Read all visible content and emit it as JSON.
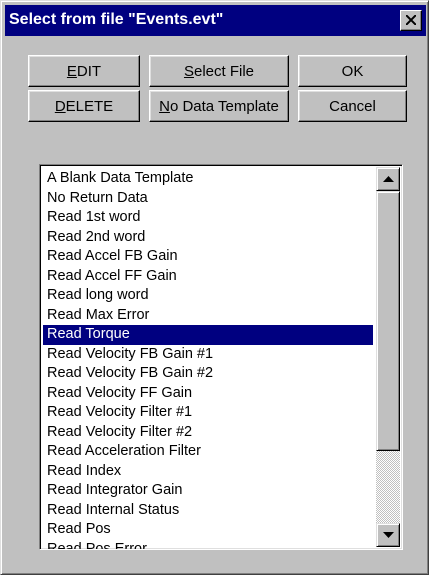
{
  "window": {
    "title": "Select from file \"Events.evt\""
  },
  "buttons": {
    "edit": {
      "label_underlined": "E",
      "label_rest": "DIT"
    },
    "select_file": {
      "label_underlined": "S",
      "label_rest": "elect File"
    },
    "ok": {
      "label": "OK"
    },
    "delete": {
      "label_underlined": "D",
      "label_rest": "ELETE"
    },
    "no_data_template": {
      "label_underlined": "N",
      "label_rest": "o Data Template"
    },
    "cancel": {
      "label": "Cancel"
    }
  },
  "list": {
    "selected_index": 8,
    "items": [
      "A Blank Data Template",
      "No Return Data",
      "Read  1st word",
      "Read  2nd word",
      "Read  Accel FB Gain",
      "Read  Accel FF Gain",
      "Read  long word",
      "Read  Max Error",
      "Read  Torque",
      "Read  Velocity FB Gain #1",
      "Read  Velocity FB Gain #2",
      "Read  Velocity FF Gain",
      "Read  Velocity Filter #1",
      "Read  Velocity Filter #2",
      "Read Acceleration Filter",
      "Read Index",
      "Read Integrator Gain",
      "Read Internal Status",
      "Read Pos",
      "Read Pos Error"
    ]
  },
  "icons": {
    "close": "close-icon",
    "scroll_up": "arrow-up-icon",
    "scroll_down": "arrow-down-icon"
  },
  "colors": {
    "titlebar": "#000080",
    "face": "#c0c0c0",
    "selection": "#000080"
  }
}
